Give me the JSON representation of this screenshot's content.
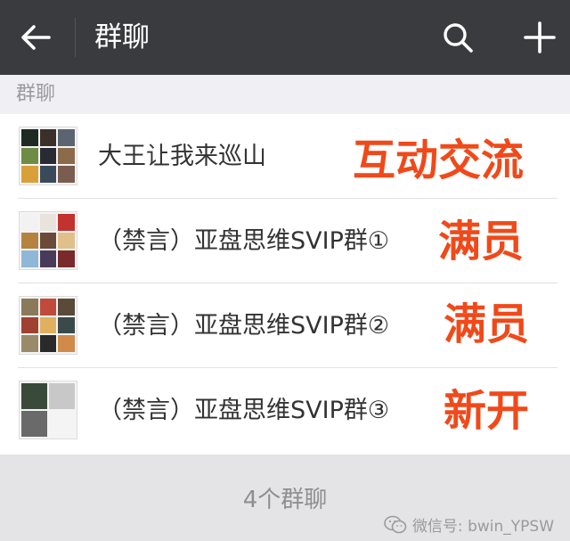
{
  "header": {
    "title": "群聊",
    "back_icon": "back-arrow-icon",
    "search_icon": "search-icon",
    "add_icon": "plus-icon"
  },
  "section": {
    "label": "群聊"
  },
  "groups": [
    {
      "name": "大王让我来巡山",
      "overlay": "互动交流"
    },
    {
      "name": "（禁言）亚盘思维SVIP群①",
      "overlay": "满员"
    },
    {
      "name": "（禁言）亚盘思维SVIP群②",
      "overlay": "满员"
    },
    {
      "name": "（禁言）亚盘思维SVIP群③",
      "overlay": "新开"
    }
  ],
  "footer": {
    "count": "4个群聊",
    "watermark": "微信号: bwin_YPSW"
  },
  "colors": {
    "topbar": "#3a3b3f",
    "overlay_text": "#f0491a"
  }
}
